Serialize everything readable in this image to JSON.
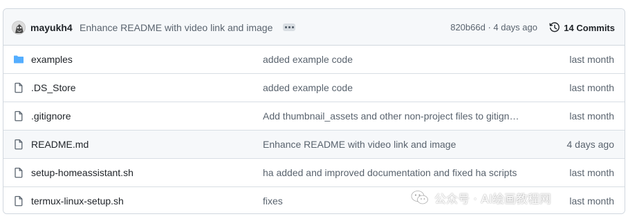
{
  "last_commit": {
    "author": "mayukh4",
    "message": "Enhance README with video link and image",
    "hash_time": "820b66d · 4 days ago",
    "commits_label": "14 Commits"
  },
  "files": [
    {
      "name": "examples",
      "type": "folder",
      "message": "added example code",
      "age": "last month"
    },
    {
      "name": ".DS_Store",
      "type": "file",
      "message": "added example code",
      "age": "last month"
    },
    {
      "name": ".gitignore",
      "type": "file",
      "message": "Add thumbnail_assets and other non-project files to gitign…",
      "age": "last month"
    },
    {
      "name": "README.md",
      "type": "file",
      "message": "Enhance README with video link and image",
      "age": "4 days ago"
    },
    {
      "name": "setup-homeassistant.sh",
      "type": "file",
      "message": "ha added and improved documentation and fixed ha scripts",
      "age": "last month"
    },
    {
      "name": "termux-linux-setup.sh",
      "type": "file",
      "message": "fixes",
      "age": "last month"
    }
  ],
  "watermark": {
    "text": "公众号 · AI绘画教程网"
  },
  "colors": {
    "folder_icon": "#54aeff",
    "file_icon": "#59636e",
    "muted_text": "#59636e",
    "border": "#d0d7de",
    "header_bg": "#f6f8fa"
  },
  "icons": {
    "folder": "folder-icon",
    "file": "file-icon",
    "history": "history-icon",
    "ellipsis": "kebab-horizontal-icon"
  }
}
